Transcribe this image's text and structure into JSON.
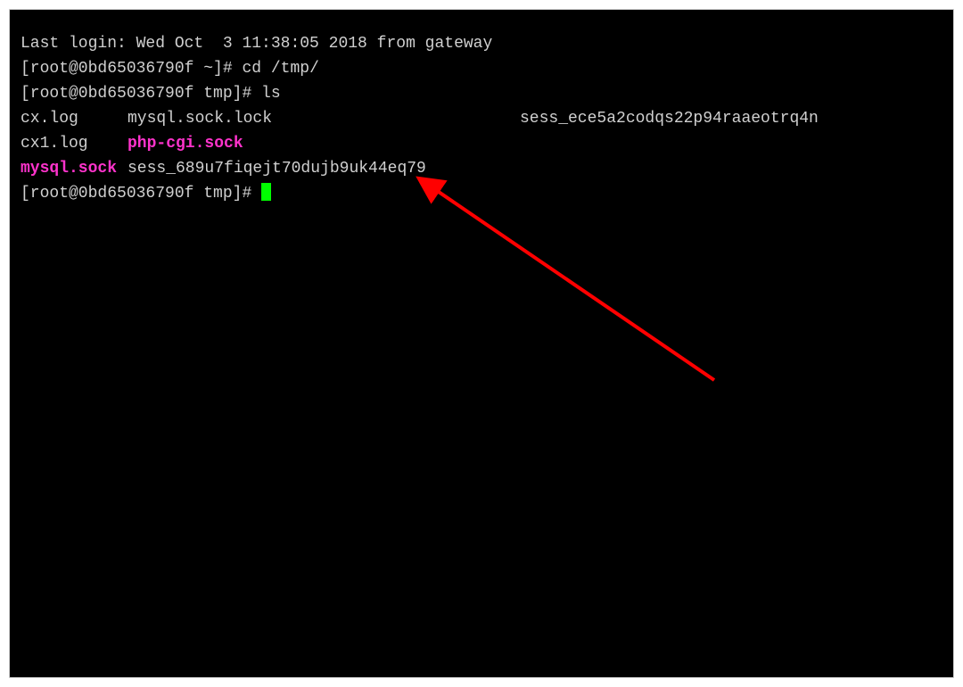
{
  "login_line": "Last login: Wed Oct  3 11:38:05 2018 from gateway",
  "prompt1": "[root@0bd65036790f ~]# ",
  "cmd1": "cd /tmp/",
  "prompt2": "[root@0bd65036790f tmp]# ",
  "cmd2": "ls",
  "files": {
    "row1": {
      "c1": "cx.log",
      "c2": "mysql.sock.lock",
      "c3": "sess_ece5a2codqs22p94raaeotrq4n"
    },
    "row2": {
      "c1": "cx1.log",
      "c2": "php-cgi.sock"
    },
    "row3": {
      "c1": "mysql.sock",
      "c2": "sess_689u7fiqejt70dujb9uk44eq79"
    }
  },
  "prompt3": "[root@0bd65036790f tmp]# ",
  "arrow_color": "#ff0000"
}
